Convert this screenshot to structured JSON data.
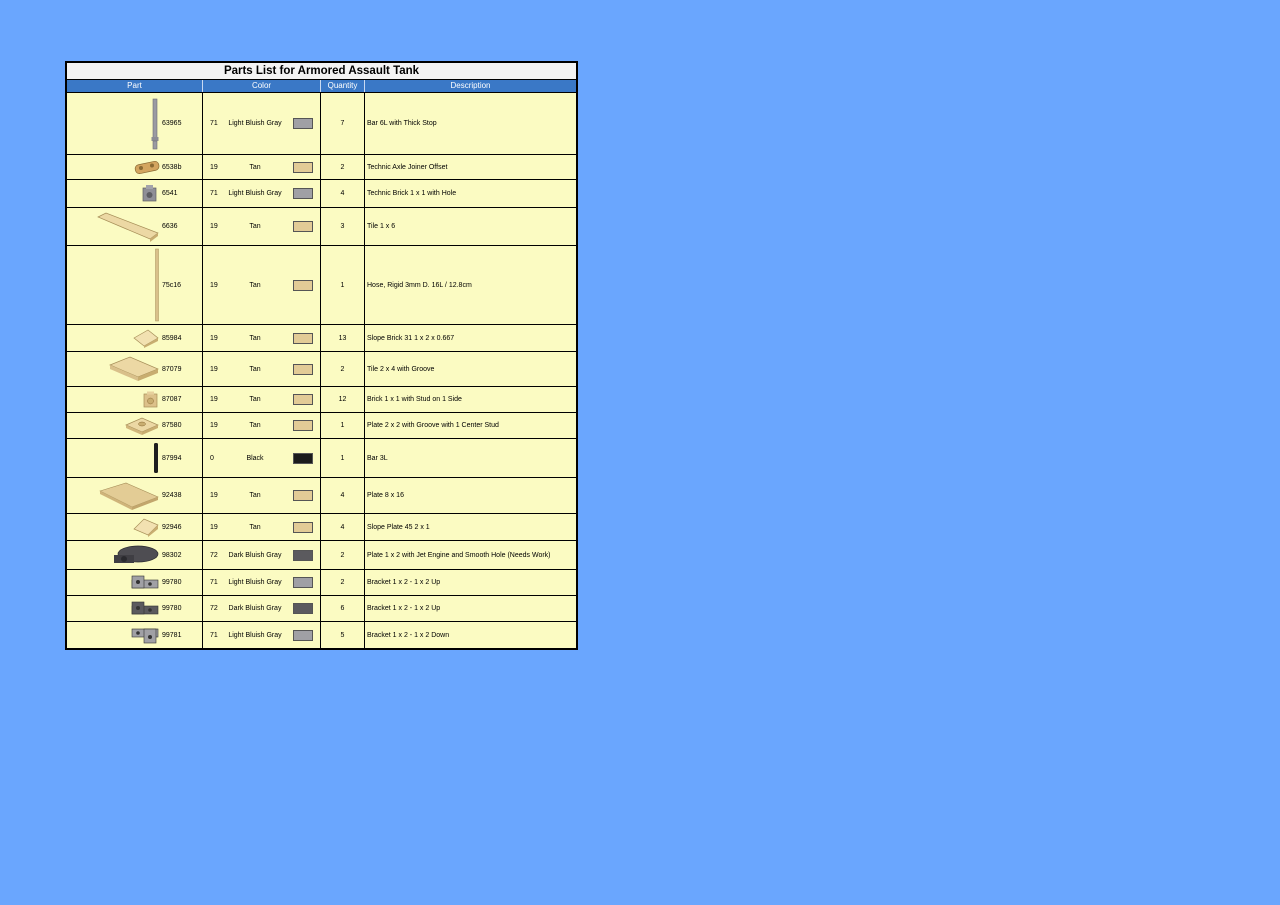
{
  "sheet": {
    "title": "Parts List for Armored Assault Tank",
    "headers": {
      "part": "Part",
      "color": "Color",
      "quantity": "Quantity",
      "description": "Description"
    },
    "colors": {
      "71": "#a0a0a5",
      "19": "#e2cb96",
      "0": "#1b1b1b",
      "72": "#5b5a5e"
    },
    "rows": [
      {
        "part_id": "63965",
        "icon": "bar-6l-icon",
        "color_code": "71",
        "color_name": "Light Bluish Gray",
        "swatch": "#a0a0a5",
        "quantity": "7",
        "description": "Bar 6L with Thick Stop"
      },
      {
        "part_id": "6538b",
        "icon": "axle-joiner-icon",
        "color_code": "19",
        "color_name": "Tan",
        "swatch": "#e2cb96",
        "quantity": "2",
        "description": "Technic Axle Joiner Offset"
      },
      {
        "part_id": "6541",
        "icon": "technic-brick-icon",
        "color_code": "71",
        "color_name": "Light Bluish Gray",
        "swatch": "#a0a0a5",
        "quantity": "4",
        "description": "Technic Brick 1 x 1 with Hole"
      },
      {
        "part_id": "6636",
        "icon": "tile-1x6-icon",
        "color_code": "19",
        "color_name": "Tan",
        "swatch": "#e2cb96",
        "quantity": "3",
        "description": "Tile 1 x 6"
      },
      {
        "part_id": "75c16",
        "icon": "hose-rigid-icon",
        "color_code": "19",
        "color_name": "Tan",
        "swatch": "#e2cb96",
        "quantity": "1",
        "description": "Hose, Rigid 3mm D. 16L / 12.8cm"
      },
      {
        "part_id": "85984",
        "icon": "slope-brick-icon",
        "color_code": "19",
        "color_name": "Tan",
        "swatch": "#e2cb96",
        "quantity": "13",
        "description": "Slope Brick 31 1 x 2 x 0.667"
      },
      {
        "part_id": "87079",
        "icon": "tile-2x4-icon",
        "color_code": "19",
        "color_name": "Tan",
        "swatch": "#e2cb96",
        "quantity": "2",
        "description": "Tile 2 x 4 with Groove"
      },
      {
        "part_id": "87087",
        "icon": "brick-side-stud-icon",
        "color_code": "19",
        "color_name": "Tan",
        "swatch": "#e2cb96",
        "quantity": "12",
        "description": "Brick 1 x 1 with Stud on 1 Side"
      },
      {
        "part_id": "87580",
        "icon": "plate-center-stud-icon",
        "color_code": "19",
        "color_name": "Tan",
        "swatch": "#e2cb96",
        "quantity": "1",
        "description": "Plate 2 x 2 with Groove with 1 Center Stud"
      },
      {
        "part_id": "87994",
        "icon": "bar-3l-icon",
        "color_code": "0",
        "color_name": "Black",
        "swatch": "#1b1b1b",
        "quantity": "1",
        "description": "Bar 3L"
      },
      {
        "part_id": "92438",
        "icon": "plate-8x16-icon",
        "color_code": "19",
        "color_name": "Tan",
        "swatch": "#e2cb96",
        "quantity": "4",
        "description": "Plate 8 x 16"
      },
      {
        "part_id": "92946",
        "icon": "slope-plate-icon",
        "color_code": "19",
        "color_name": "Tan",
        "swatch": "#e2cb96",
        "quantity": "4",
        "description": "Slope Plate 45 2 x 1"
      },
      {
        "part_id": "98302",
        "icon": "jet-engine-plate-icon",
        "color_code": "72",
        "color_name": "Dark Bluish Gray",
        "swatch": "#5b5a5e",
        "quantity": "2",
        "description": "Plate 1 x 2 with Jet Engine and Smooth Hole (Needs Work)"
      },
      {
        "part_id": "99780",
        "icon": "bracket-up-icon",
        "color_code": "71",
        "color_name": "Light Bluish Gray",
        "swatch": "#a0a0a5",
        "quantity": "2",
        "description": "Bracket 1 x 2 - 1 x 2 Up"
      },
      {
        "part_id": "99780",
        "icon": "bracket-up-icon",
        "color_code": "72",
        "color_name": "Dark Bluish Gray",
        "swatch": "#5b5a5e",
        "quantity": "6",
        "description": "Bracket 1 x 2 - 1 x 2 Up"
      },
      {
        "part_id": "99781",
        "icon": "bracket-down-icon",
        "color_code": "71",
        "color_name": "Light Bluish Gray",
        "swatch": "#a0a0a5",
        "quantity": "5",
        "description": "Bracket 1 x 2 - 1 x 2 Down"
      }
    ]
  }
}
